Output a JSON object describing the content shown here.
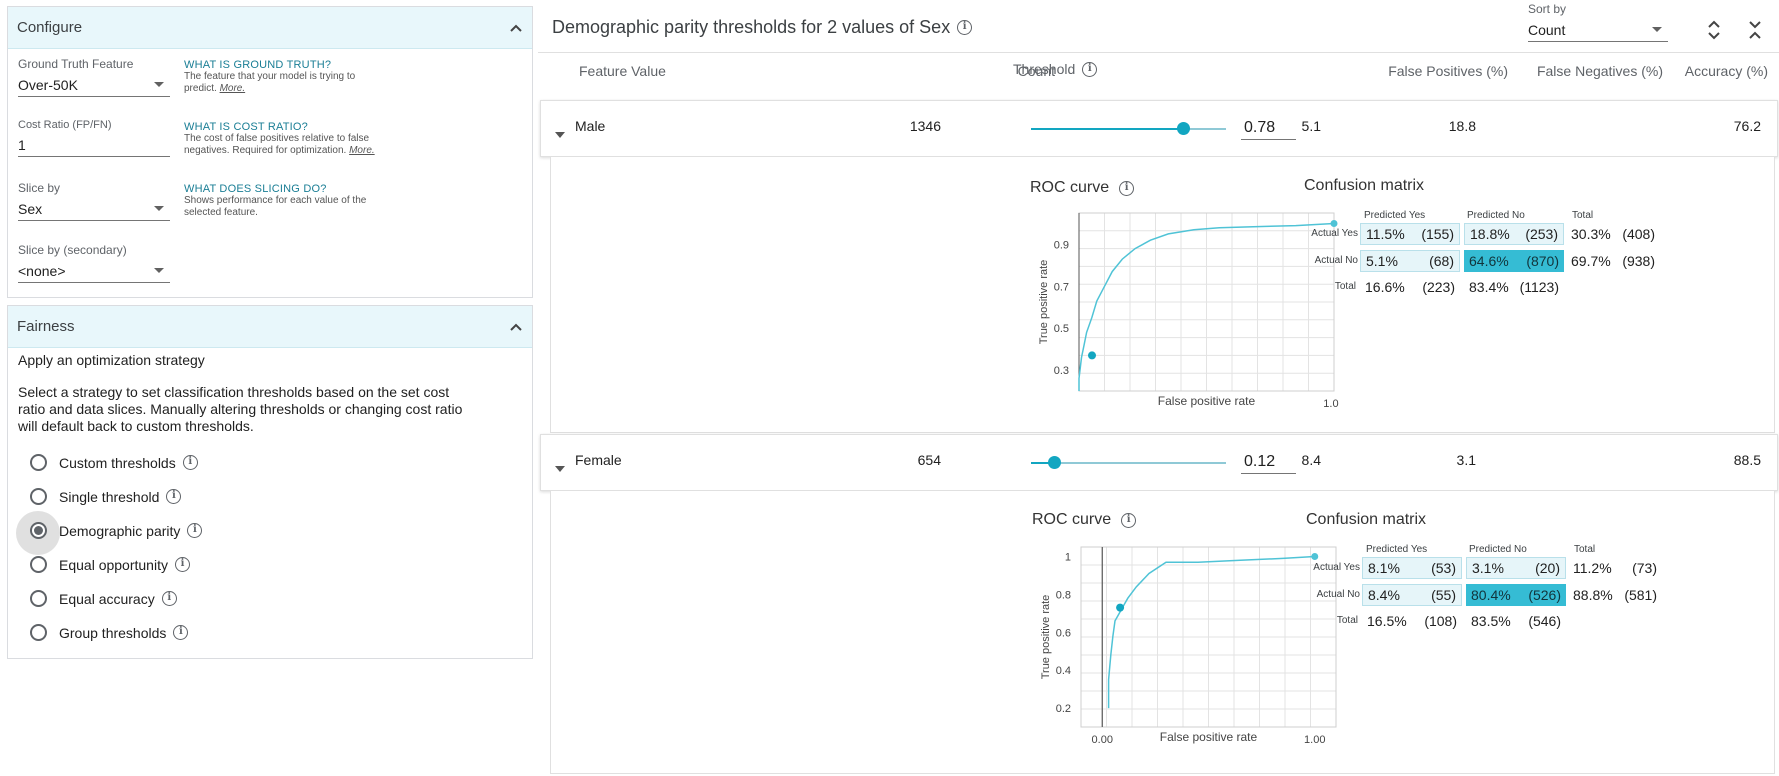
{
  "configure": {
    "title": "Configure",
    "ground_truth": {
      "label": "Ground Truth Feature",
      "value": "Over-50K",
      "help_title": "WHAT IS GROUND TRUTH?",
      "help_text": "The feature that your model is trying to predict.",
      "more": "More."
    },
    "cost_ratio": {
      "label": "Cost Ratio (FP/FN)",
      "value": "1",
      "help_title": "WHAT IS COST RATIO?",
      "help_text": "The cost of false positives relative to false negatives. Required for optimization.",
      "more": "More."
    },
    "slice_by": {
      "label": "Slice by",
      "value": "Sex",
      "help_title": "WHAT DOES SLICING DO?",
      "help_text": "Shows performance for each value of the selected feature."
    },
    "slice_by_secondary": {
      "label": "Slice by (secondary)",
      "value": "<none>"
    }
  },
  "fairness": {
    "title": "Fairness",
    "subtitle": "Apply an optimization strategy",
    "description": "Select a strategy to set classification thresholds based on the set cost ratio and data slices. Manually altering thresholds or changing cost ratio will default back to custom thresholds.",
    "options": [
      {
        "label": "Custom thresholds",
        "selected": false
      },
      {
        "label": "Single threshold",
        "selected": false
      },
      {
        "label": "Demographic parity",
        "selected": true
      },
      {
        "label": "Equal opportunity",
        "selected": false
      },
      {
        "label": "Equal accuracy",
        "selected": false
      },
      {
        "label": "Group thresholds",
        "selected": false
      }
    ]
  },
  "header": {
    "title": "Demographic parity thresholds for 2 values of Sex",
    "sort_label": "Sort by",
    "sort_value": "Count"
  },
  "columns": {
    "feature_value": "Feature Value",
    "count": "Count",
    "threshold": "Threshold",
    "fp": "False Positives (%)",
    "fn": "False Negatives (%)",
    "accuracy": "Accuracy (%)"
  },
  "rows": [
    {
      "name": "Male",
      "count": "1346",
      "threshold": "0.78",
      "threshold_value": 0.78,
      "fp": "5.1",
      "fn": "18.8",
      "accuracy": "76.2",
      "roc_title": "ROC curve",
      "roc": {
        "xlabel": "False positive rate",
        "ylabel": "True positive rate",
        "yticks": [
          "0.9",
          "0.7",
          "0.5",
          "0.3"
        ],
        "xticks": [
          "1.00"
        ],
        "chart_data": {
          "type": "line",
          "x": [
            0.0,
            0.0,
            0.01,
            0.02,
            0.03,
            0.05,
            0.07,
            0.1,
            0.13,
            0.17,
            0.22,
            0.28,
            0.35,
            0.45,
            0.55,
            0.7,
            0.85,
            1.0
          ],
          "y": [
            0.2,
            0.26,
            0.36,
            0.42,
            0.48,
            0.55,
            0.63,
            0.7,
            0.77,
            0.83,
            0.88,
            0.92,
            0.95,
            0.97,
            0.98,
            0.985,
            0.99,
            1.0
          ],
          "marker": {
            "x": 0.051,
            "y": 0.37
          },
          "xlim": [
            0,
            1
          ],
          "ylim": [
            0.2,
            1.05
          ]
        }
      },
      "cm": {
        "title": "Confusion matrix",
        "col_headers": [
          "Predicted Yes",
          "Predicted No",
          "Total"
        ],
        "row_headers": [
          "Actual Yes",
          "Actual No",
          "Total"
        ],
        "cells": [
          [
            [
              "11.5%",
              "(155)"
            ],
            [
              "18.8%",
              "(253)"
            ],
            [
              "30.3%",
              "(408)"
            ]
          ],
          [
            [
              "5.1%",
              "(68)"
            ],
            [
              "64.6%",
              "(870)"
            ],
            [
              "69.7%",
              "(938)"
            ]
          ],
          [
            [
              "16.6%",
              "(223)"
            ],
            [
              "83.4%",
              "(1123)"
            ]
          ]
        ]
      }
    },
    {
      "name": "Female",
      "count": "654",
      "threshold": "0.12",
      "threshold_value": 0.12,
      "fp": "8.4",
      "fn": "3.1",
      "accuracy": "88.5",
      "roc_title": "ROC curve",
      "roc": {
        "xlabel": "False positive rate",
        "ylabel": "True positive rate",
        "yticks": [
          "1",
          "0.8",
          "0.6",
          "0.4",
          "0.2"
        ],
        "xticks": [
          "0.00",
          "1.00"
        ],
        "chart_data": {
          "type": "line",
          "x": [
            0.03,
            0.03,
            0.04,
            0.05,
            0.06,
            0.08,
            0.1,
            0.12,
            0.16,
            0.22,
            0.3,
            0.45,
            0.65,
            0.85,
            1.0
          ],
          "y": [
            0.2,
            0.35,
            0.48,
            0.58,
            0.66,
            0.7,
            0.74,
            0.78,
            0.84,
            0.91,
            0.97,
            0.97,
            0.98,
            0.99,
            1.0
          ],
          "marker": {
            "x": 0.084,
            "y": 0.73
          },
          "xlim": [
            -0.1,
            1.1
          ],
          "ylim": [
            0.1,
            1.05
          ]
        }
      },
      "cm": {
        "title": "Confusion matrix",
        "col_headers": [
          "Predicted Yes",
          "Predicted No",
          "Total"
        ],
        "row_headers": [
          "Actual Yes",
          "Actual No",
          "Total"
        ],
        "cells": [
          [
            [
              "8.1%",
              "(53)"
            ],
            [
              "3.1%",
              "(20)"
            ],
            [
              "11.2%",
              "(73)"
            ]
          ],
          [
            [
              "8.4%",
              "(55)"
            ],
            [
              "80.4%",
              "(526)"
            ],
            [
              "88.8%",
              "(581)"
            ]
          ],
          [
            [
              "16.5%",
              "(108)"
            ],
            [
              "83.5%",
              "(546)"
            ]
          ]
        ]
      }
    }
  ],
  "colors": {
    "accent": "#12a6c1",
    "roc_line": "#4fc3d6",
    "cm_dark": "#35bcd4",
    "cm_light": "#e6f5f9"
  }
}
